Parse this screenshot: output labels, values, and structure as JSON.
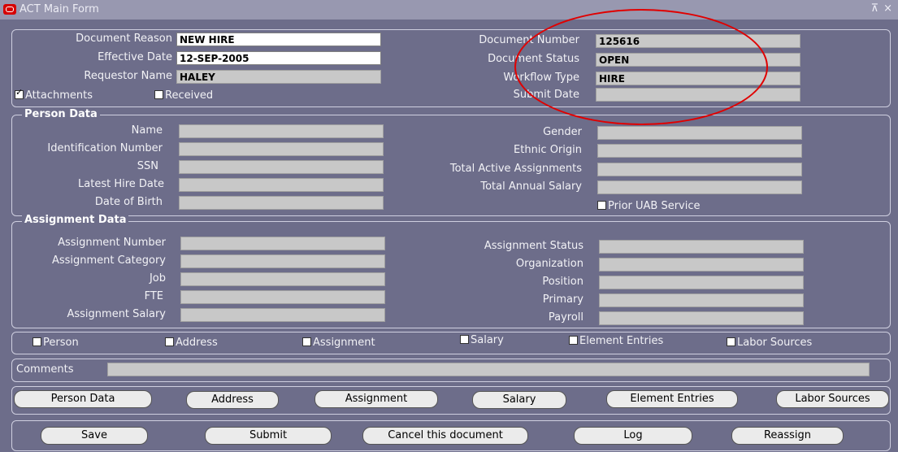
{
  "window": {
    "title": "ACT Main Form",
    "controls": "⊼ ×"
  },
  "header": {
    "doc_reason_label": "Document Reason",
    "doc_reason_value": "NEW HIRE",
    "effective_date_label": "Effective Date",
    "effective_date_value": "12-SEP-2005",
    "requestor_label": "Requestor Name",
    "requestor_value": "HALEY",
    "doc_number_label": "Document Number",
    "doc_number_value": "125616",
    "doc_status_label": "Document Status",
    "doc_status_value": "OPEN",
    "workflow_label": "Workflow Type",
    "workflow_value": "HIRE",
    "submit_date_label": "Submit Date",
    "submit_date_value": "",
    "attachments_label": "Attachments",
    "received_label": "Received"
  },
  "person": {
    "title": "Person Data",
    "name_label": "Name",
    "id_label": "Identification Number",
    "ssn_label": "SSN",
    "hire_label": "Latest Hire Date",
    "dob_label": "Date of Birth",
    "gender_label": "Gender",
    "ethnic_label": "Ethnic Origin",
    "total_assign_label": "Total Active Assignments",
    "total_salary_label": "Total Annual Salary",
    "prior_uab_label": "Prior UAB Service"
  },
  "assignment": {
    "title": "Assignment Data",
    "number_label": "Assignment Number",
    "category_label": "Assignment Category",
    "job_label": "Job",
    "fte_label": "FTE",
    "salary_label": "Assignment Salary",
    "status_label": "Assignment Status",
    "org_label": "Organization",
    "position_label": "Position",
    "primary_label": "Primary",
    "payroll_label": "Payroll"
  },
  "checks": [
    "Person",
    "Address",
    "Assignment",
    "Salary",
    "Element Entries",
    "Labor Sources"
  ],
  "comments_label": "Comments",
  "nav_buttons": [
    "Person Data",
    "Address",
    "Assignment",
    "Salary",
    "Element Entries",
    "Labor Sources"
  ],
  "action_buttons": [
    "Save",
    "Submit",
    "Cancel this document",
    "Log",
    "Reassign"
  ],
  "colors": {
    "background": "#6d6d8a",
    "annotation": "#e00000"
  }
}
